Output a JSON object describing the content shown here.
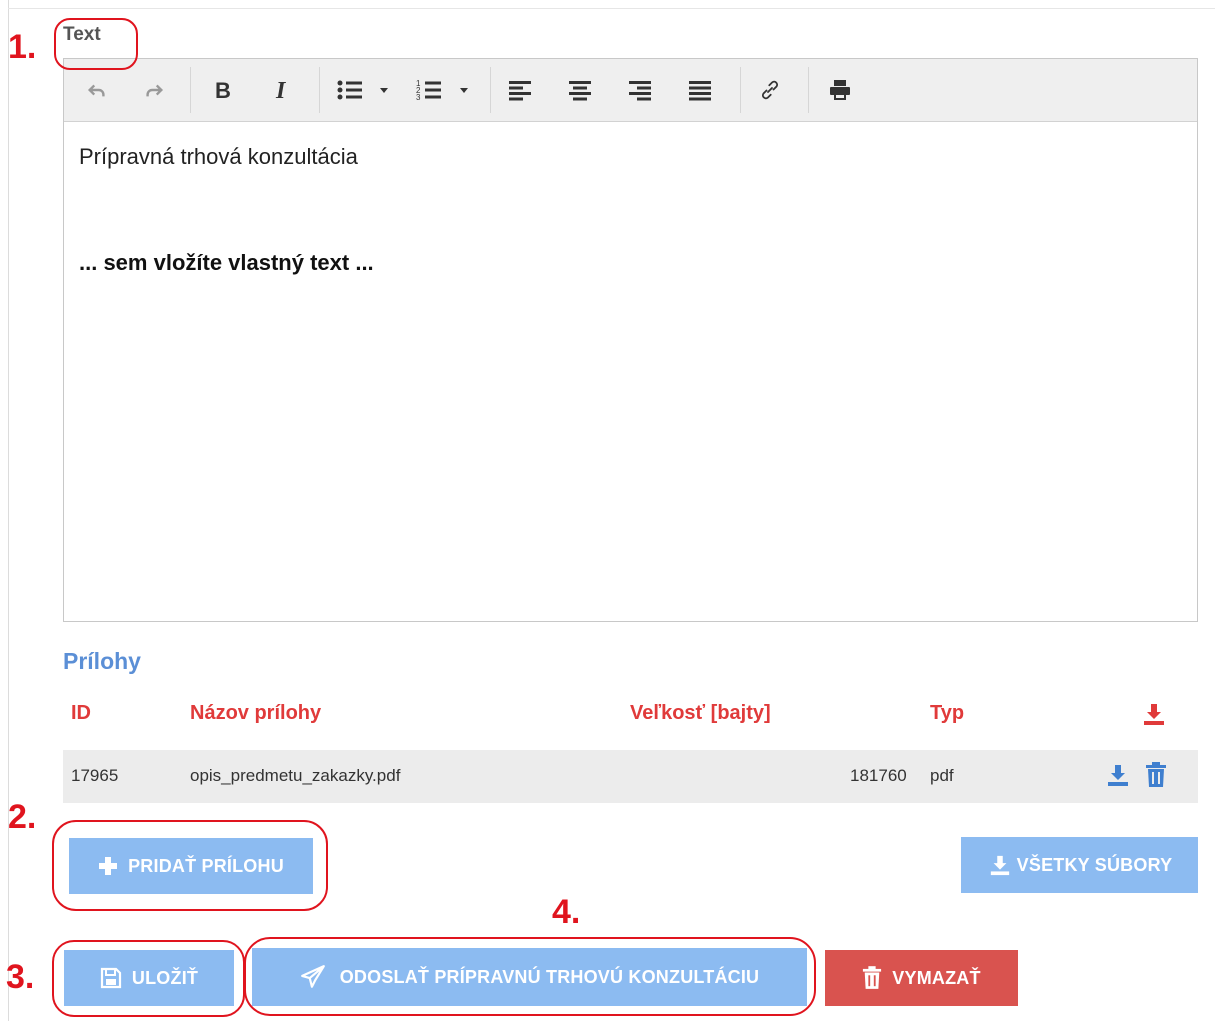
{
  "markers": {
    "m1": "1.",
    "m2": "2.",
    "m3": "3.",
    "m4": "4."
  },
  "editor": {
    "label": "Text",
    "content": {
      "line1": "Prípravná trhová konzultácia",
      "line2": "... sem vložíte vlastný text ..."
    },
    "toolbar_icons": [
      "undo-icon",
      "redo-icon",
      "bold-icon",
      "italic-icon",
      "bullet-list-icon",
      "numbered-list-icon",
      "align-left-icon",
      "align-center-icon",
      "align-right-icon",
      "align-justify-icon",
      "link-icon",
      "print-icon"
    ]
  },
  "attachments": {
    "title": "Prílohy",
    "columns": {
      "id": "ID",
      "name": "Názov prílohy",
      "size": "Veľkosť [bajty]",
      "type": "Typ"
    },
    "rows": [
      {
        "id": "17965",
        "name": "opis_predmetu_zakazky.pdf",
        "size": "181760",
        "type": "pdf"
      }
    ]
  },
  "buttons": {
    "add_attachment": "PRIDAŤ PRÍLOHU",
    "all_files": "VŠETKY SÚBORY",
    "save": "ULOŽIŤ",
    "send": "ODOSLAŤ PRÍPRAVNÚ TRHOVÚ KONZULTÁCIU",
    "delete": "VYMAZAŤ"
  },
  "colors": {
    "annotation_red": "#e0141e",
    "header_red": "#e03a3a",
    "title_blue": "#5b8fd6",
    "icon_blue": "#3f7fcf",
    "button_blue": "#8cbbf1",
    "button_red": "#d9534f"
  }
}
